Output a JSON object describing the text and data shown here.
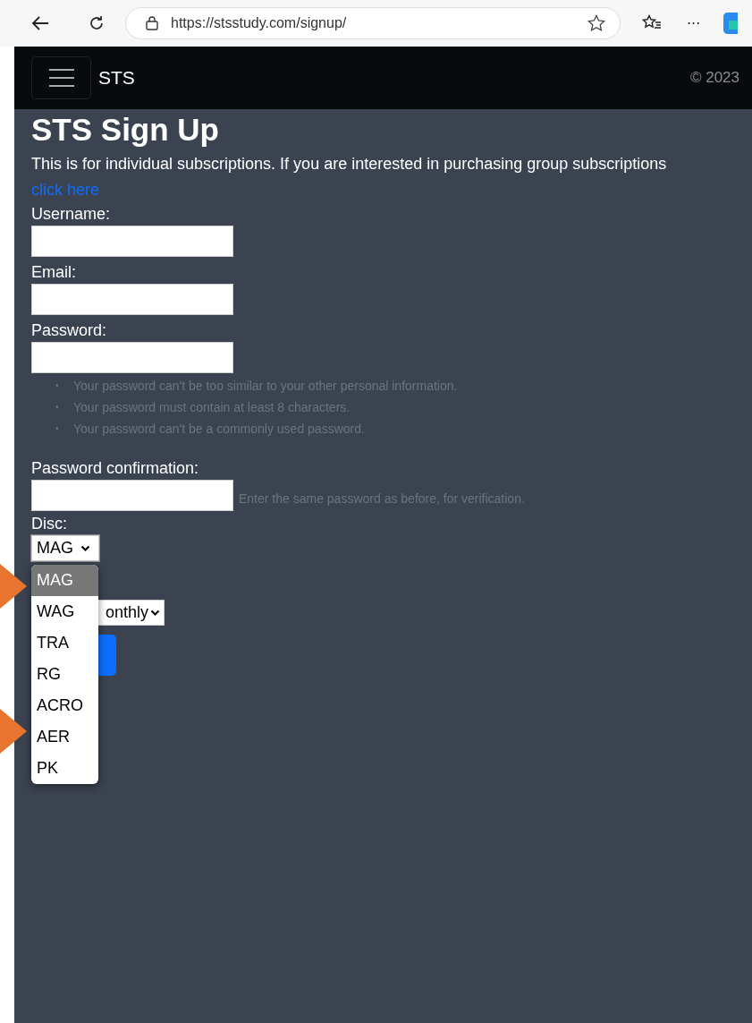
{
  "browser": {
    "url": "https://stsstudy.com/signup/",
    "menu": "···"
  },
  "navbar": {
    "brand": "STS",
    "copyright": "© 2023"
  },
  "page": {
    "title": "STS Sign Up",
    "intro": "This is for individual subscriptions. If you are interested in purchasing group subscriptions",
    "link": "click here"
  },
  "fields": [
    {
      "label": "Username:",
      "kind": "text"
    },
    {
      "label": "Email:",
      "kind": "text"
    },
    {
      "label": "Password:",
      "kind": "text",
      "help_list": [
        {
          "bullet": "•",
          "text": "Your password can't be too similar to your other personal information."
        },
        {
          "bullet": "•",
          "text": "Your password must contain at least 8 characters."
        },
        {
          "bullet": "•",
          "text": "Your password can't be a commonly used password."
        }
      ]
    },
    {
      "label": "Password confirmation:",
      "kind": "text",
      "help": "Enter the same password as before, for verification."
    },
    {
      "label": "Disc:",
      "kind": "select",
      "value": "MAG",
      "expanded": true,
      "options": [
        {
          "label": "MAG",
          "selected": true
        },
        {
          "label": "WAG",
          "selected": false
        },
        {
          "label": "TRA",
          "selected": false
        },
        {
          "label": "RG",
          "selected": false
        },
        {
          "label": "ACRO",
          "selected": false
        },
        {
          "label": "AER",
          "selected": false
        },
        {
          "label": "PK",
          "selected": false
        }
      ]
    },
    {
      "kind": "select",
      "value": "onthly"
    }
  ],
  "submit": {
    "kind": "button"
  }
}
